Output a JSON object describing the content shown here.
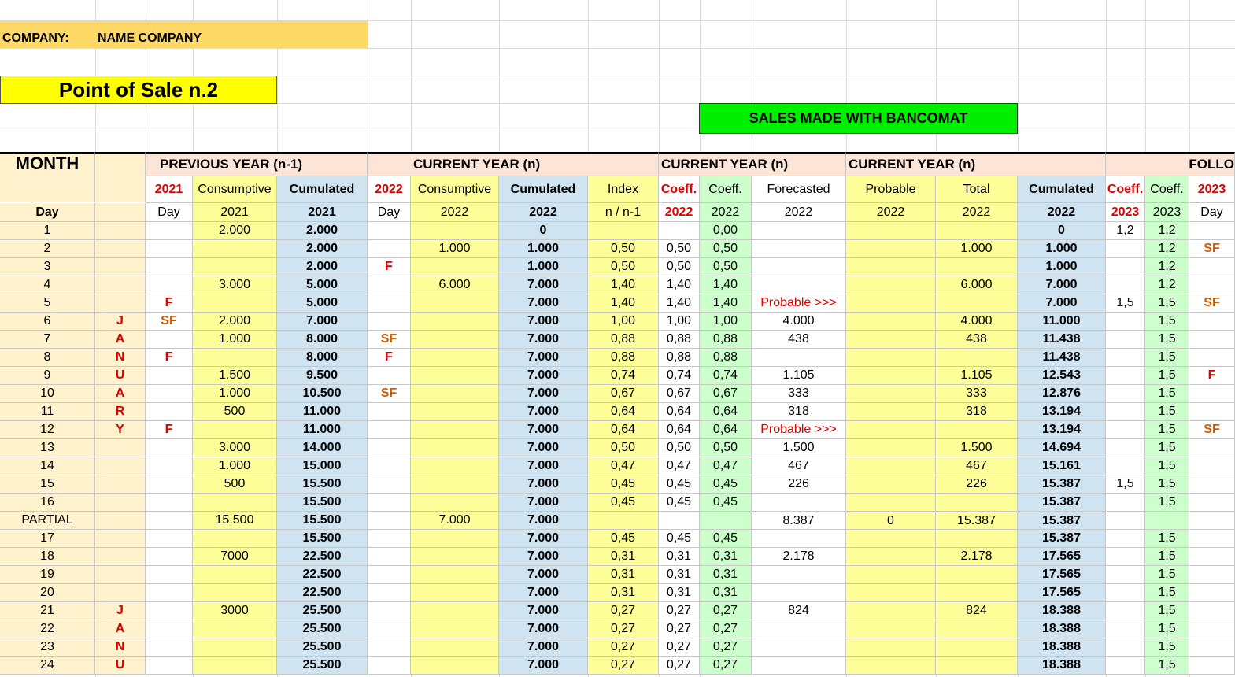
{
  "company": {
    "label": "COMPANY:",
    "name": "NAME COMPANY"
  },
  "pos_title": "Point of Sale n.2",
  "sales_banner": "SALES MADE WITH BANCOMAT",
  "colors": {
    "yellow": "#ffff99",
    "blue": "#cfe3f1",
    "green_light": "#ccffcc",
    "header_peach": "#fce4d6",
    "cream": "#fff2cc",
    "company_orange": "#ffd966",
    "banner_yellow": "#ffff00",
    "banner_green": "#00ee00",
    "red": "#e00000",
    "orange": "#d05a00"
  },
  "headers": {
    "month": "MONTH",
    "group_prev": "PREVIOUS YEAR (n-1)",
    "group_cur1": "CURRENT YEAR (n)",
    "group_cur2": "CURRENT YEAR (n)",
    "group_cur3": "CURRENT YEAR (n)",
    "group_follow": "FOLLO",
    "row1": [
      "",
      "",
      "2021",
      "Consumptive",
      "Cumulated",
      "2022",
      "Consumptive",
      "Cumulated",
      "Index",
      "Coeff.",
      "Coeff.",
      "Forecasted",
      "Probable",
      "Total",
      "Cumulated",
      "Coeff.",
      "Coeff.",
      "2023"
    ],
    "row2": [
      "Day",
      "",
      "Day",
      "2021",
      "2021",
      "Day",
      "2022",
      "2022",
      "n / n-1",
      "2022",
      "2022",
      "2022",
      "2022",
      "2022",
      "2022",
      "2023",
      "2023",
      "Day"
    ]
  },
  "rows": [
    [
      "1",
      "",
      "",
      "2.000",
      "2.000",
      "",
      "",
      "0",
      "",
      "",
      "0,00",
      "",
      "",
      "",
      "0",
      "1,2",
      "1,2",
      ""
    ],
    [
      "2",
      "",
      "",
      "",
      "2.000",
      "",
      "1.000",
      "1.000",
      "0,50",
      "0,50",
      "0,50",
      "",
      "",
      "1.000",
      "1.000",
      "",
      "1,2",
      "SF"
    ],
    [
      "3",
      "",
      "",
      "",
      "2.000",
      "F",
      "",
      "1.000",
      "0,50",
      "0,50",
      "0,50",
      "",
      "",
      "",
      "1.000",
      "",
      "1,2",
      ""
    ],
    [
      "4",
      "",
      "",
      "3.000",
      "5.000",
      "",
      "6.000",
      "7.000",
      "1,40",
      "1,40",
      "1,40",
      "",
      "",
      "6.000",
      "7.000",
      "",
      "1,2",
      ""
    ],
    [
      "5",
      "",
      "F",
      "",
      "5.000",
      "",
      "",
      "7.000",
      "1,40",
      "1,40",
      "1,40",
      "Probable >>>",
      "",
      "",
      "7.000",
      "1,5",
      "1,5",
      "SF"
    ],
    [
      "6",
      "J",
      "SF",
      "2.000",
      "7.000",
      "",
      "",
      "7.000",
      "1,00",
      "1,00",
      "1,00",
      "4.000",
      "",
      "4.000",
      "11.000",
      "",
      "1,5",
      ""
    ],
    [
      "7",
      "A",
      "",
      "1.000",
      "8.000",
      "SF",
      "",
      "7.000",
      "0,88",
      "0,88",
      "0,88",
      "438",
      "",
      "438",
      "11.438",
      "",
      "1,5",
      ""
    ],
    [
      "8",
      "N",
      "F",
      "",
      "8.000",
      "F",
      "",
      "7.000",
      "0,88",
      "0,88",
      "0,88",
      "",
      "",
      "",
      "11.438",
      "",
      "1,5",
      ""
    ],
    [
      "9",
      "U",
      "",
      "1.500",
      "9.500",
      "",
      "",
      "7.000",
      "0,74",
      "0,74",
      "0,74",
      "1.105",
      "",
      "1.105",
      "12.543",
      "",
      "1,5",
      "F"
    ],
    [
      "10",
      "A",
      "",
      "1.000",
      "10.500",
      "SF",
      "",
      "7.000",
      "0,67",
      "0,67",
      "0,67",
      "333",
      "",
      "333",
      "12.876",
      "",
      "1,5",
      ""
    ],
    [
      "11",
      "R",
      "",
      "500",
      "11.000",
      "",
      "",
      "7.000",
      "0,64",
      "0,64",
      "0,64",
      "318",
      "",
      "318",
      "13.194",
      "",
      "1,5",
      ""
    ],
    [
      "12",
      "Y",
      "F",
      "",
      "11.000",
      "",
      "",
      "7.000",
      "0,64",
      "0,64",
      "0,64",
      "Probable >>>",
      "",
      "",
      "13.194",
      "",
      "1,5",
      "SF"
    ],
    [
      "13",
      "",
      "",
      "3.000",
      "14.000",
      "",
      "",
      "7.000",
      "0,50",
      "0,50",
      "0,50",
      "1.500",
      "",
      "1.500",
      "14.694",
      "",
      "1,5",
      ""
    ],
    [
      "14",
      "",
      "",
      "1.000",
      "15.000",
      "",
      "",
      "7.000",
      "0,47",
      "0,47",
      "0,47",
      "467",
      "",
      "467",
      "15.161",
      "",
      "1,5",
      ""
    ],
    [
      "15",
      "",
      "",
      "500",
      "15.500",
      "",
      "",
      "7.000",
      "0,45",
      "0,45",
      "0,45",
      "226",
      "",
      "226",
      "15.387",
      "1,5",
      "1,5",
      ""
    ],
    [
      "16",
      "",
      "",
      "",
      "15.500",
      "",
      "",
      "7.000",
      "0,45",
      "0,45",
      "0,45",
      "",
      "",
      "",
      "15.387",
      "",
      "1,5",
      ""
    ],
    [
      "PARTIAL",
      "",
      "",
      "15.500",
      "15.500",
      "",
      "7.000",
      "7.000",
      "",
      "",
      "",
      "8.387",
      "0",
      "15.387",
      "15.387",
      "",
      "",
      ""
    ],
    [
      "17",
      "",
      "",
      "",
      "15.500",
      "",
      "",
      "7.000",
      "0,45",
      "0,45",
      "0,45",
      "",
      "",
      "",
      "15.387",
      "",
      "1,5",
      ""
    ],
    [
      "18",
      "",
      "",
      "7000",
      "22.500",
      "",
      "",
      "7.000",
      "0,31",
      "0,31",
      "0,31",
      "2.178",
      "",
      "2.178",
      "17.565",
      "",
      "1,5",
      ""
    ],
    [
      "19",
      "",
      "",
      "",
      "22.500",
      "",
      "",
      "7.000",
      "0,31",
      "0,31",
      "0,31",
      "",
      "",
      "",
      "17.565",
      "",
      "1,5",
      ""
    ],
    [
      "20",
      "",
      "",
      "",
      "22.500",
      "",
      "",
      "7.000",
      "0,31",
      "0,31",
      "0,31",
      "",
      "",
      "",
      "17.565",
      "",
      "1,5",
      ""
    ],
    [
      "21",
      "J",
      "",
      "3000",
      "25.500",
      "",
      "",
      "7.000",
      "0,27",
      "0,27",
      "0,27",
      "824",
      "",
      "824",
      "18.388",
      "",
      "1,5",
      ""
    ],
    [
      "22",
      "A",
      "",
      "",
      "25.500",
      "",
      "",
      "7.000",
      "0,27",
      "0,27",
      "0,27",
      "",
      "",
      "",
      "18.388",
      "",
      "1,5",
      ""
    ],
    [
      "23",
      "N",
      "",
      "",
      "25.500",
      "",
      "",
      "7.000",
      "0,27",
      "0,27",
      "0,27",
      "",
      "",
      "",
      "18.388",
      "",
      "1,5",
      ""
    ],
    [
      "24",
      "U",
      "",
      "",
      "25.500",
      "",
      "",
      "7.000",
      "0,27",
      "0,27",
      "0,27",
      "",
      "",
      "",
      "18.388",
      "",
      "1,5",
      ""
    ]
  ]
}
